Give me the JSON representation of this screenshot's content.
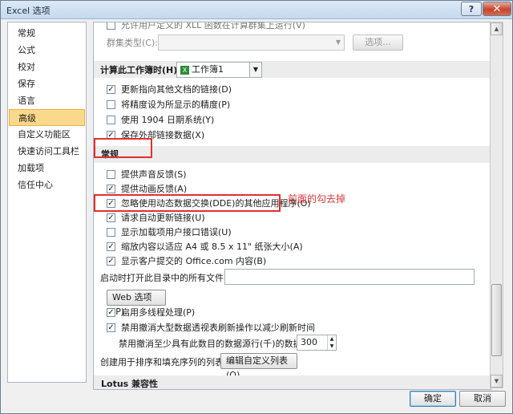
{
  "window": {
    "title": "Excel 选项",
    "help_glyph": "?",
    "close_glyph": "✕"
  },
  "sidebar": {
    "items": [
      {
        "label": "常规",
        "selected": false
      },
      {
        "label": "公式",
        "selected": false
      },
      {
        "label": "校对",
        "selected": false
      },
      {
        "label": "保存",
        "selected": false
      },
      {
        "label": "语言",
        "selected": false
      },
      {
        "label": "高级",
        "selected": true
      },
      {
        "label": "自定义功能区",
        "selected": false
      },
      {
        "label": "快速访问工具栏",
        "selected": false
      },
      {
        "label": "加载项",
        "selected": false
      },
      {
        "label": "信任中心",
        "selected": false
      }
    ]
  },
  "content": {
    "partial_top_label": "允许用户定义的 XLL 函数在计算群集上运行(V)",
    "cluster_type_label": "群集类型(C):",
    "cluster_options_button": "选项...",
    "workbook_calc_label": "计算此工作簿时(H):",
    "workbook_calc_value": "工作簿1",
    "workbook_checks": [
      {
        "label": "更新指向其他文档的链接(D)",
        "checked": true
      },
      {
        "label": "将精度设为所显示的精度(P)",
        "checked": false
      },
      {
        "label": "使用 1904 日期系统(Y)",
        "checked": false
      },
      {
        "label": "保存外部链接数据(X)",
        "checked": true
      }
    ],
    "general_section_title": "常规",
    "general_checks": [
      {
        "label": "提供声音反馈(S)",
        "checked": false
      },
      {
        "label": "提供动画反馈(A)",
        "checked": true
      },
      {
        "label": "忽略使用动态数据交换(DDE)的其他应用程序(O)",
        "checked": true
      },
      {
        "label": "请求自动更新链接(U)",
        "checked": true
      },
      {
        "label": "显示加载项用户接口错误(U)",
        "checked": false
      },
      {
        "label": "缩放内容以适应 A4 或 8.5 x 11\" 纸张大小(A)",
        "checked": true
      },
      {
        "label": "显示客户提交的 Office.com 内容(B)",
        "checked": true
      }
    ],
    "startup_open_label": "启动时打开此目录中的所有文件(L):",
    "startup_open_value": "",
    "web_options_button": "Web 选项(P)...",
    "multithread_label": "启用多线程处理(P)",
    "multithread_checked": true,
    "pivot_undo_label": "禁用撤消大型数据透视表刷新操作以减少刷新时间",
    "pivot_undo_checked": true,
    "pivot_undo_min_label": "禁用撤消至少具有此数目的数据源行(千)的数据透视表:",
    "pivot_undo_min_value": "300",
    "sort_list_label": "创建用于排序和填充序列的列表:",
    "edit_custom_lists_button": "编辑自定义列表(O)...",
    "lotus_section_title": "Lotus 兼容性"
  },
  "annotation": "前面的勾去掉",
  "footer": {
    "ok_button": "确定",
    "cancel_button": "取消"
  }
}
